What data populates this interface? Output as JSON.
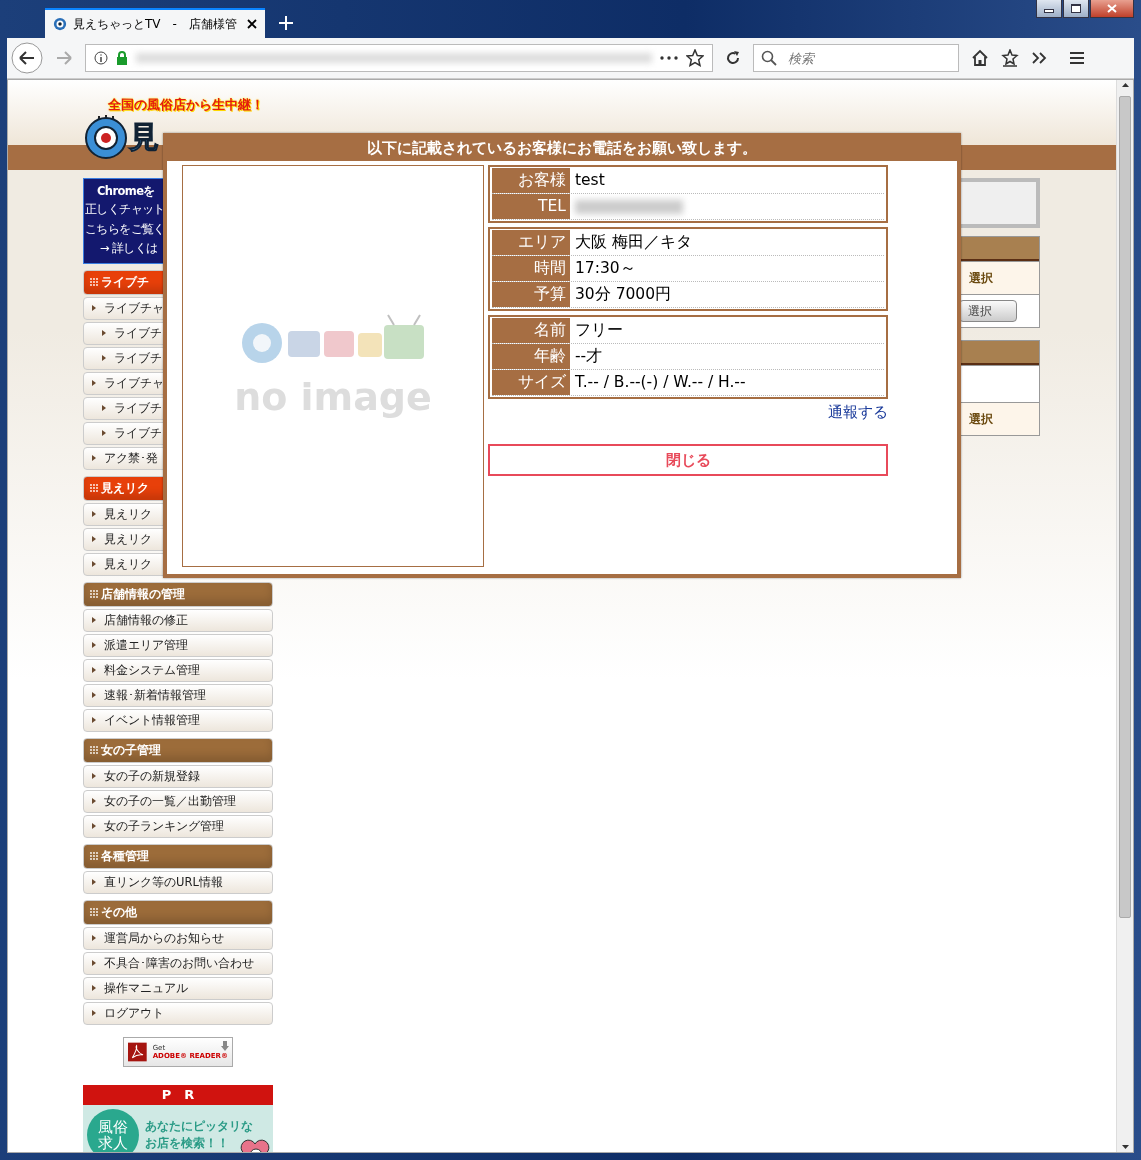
{
  "browser": {
    "tab_title": "見えちゃっとTV　-　店舗様管",
    "search_placeholder": "検索"
  },
  "header": {
    "tagline": "全国の風俗店から生中継！",
    "logo_parts": [
      "見"
    ]
  },
  "notice": {
    "title": "Chromeを",
    "lines": [
      "正しくチャット",
      "こちらをご覧く",
      "→ 詳しくは"
    ]
  },
  "sidebar": [
    {
      "title": "ライブチ",
      "color": "#e8400a",
      "items": [
        {
          "label": "ライブチャ",
          "children": [
            {
              "label": "ライブチ"
            },
            {
              "label": "ライブチ"
            }
          ]
        },
        {
          "label": "ライブチャ",
          "children": [
            {
              "label": "ライブチ"
            },
            {
              "label": "ライブチ"
            }
          ]
        },
        {
          "label": "アク禁･発"
        }
      ]
    },
    {
      "title": "見えリク",
      "color": "#e8400a",
      "items": [
        {
          "label": "見えリク"
        },
        {
          "label": "見えリク"
        },
        {
          "label": "見えリク"
        }
      ]
    },
    {
      "title": "店舗情報の管理",
      "color": "#9c6c3a",
      "items": [
        {
          "label": "店舗情報の修正"
        },
        {
          "label": "派遣エリア管理"
        },
        {
          "label": "料金システム管理"
        },
        {
          "label": "速報･新着情報管理"
        },
        {
          "label": "イベント情報管理"
        }
      ]
    },
    {
      "title": "女の子管理",
      "color": "#9c6c3a",
      "items": [
        {
          "label": "女の子の新規登録"
        },
        {
          "label": "女の子の一覧／出勤管理"
        },
        {
          "label": "女の子ランキング管理"
        }
      ]
    },
    {
      "title": "各種管理",
      "color": "#9c6c3a",
      "items": [
        {
          "label": "直リンク等のURL情報"
        }
      ]
    },
    {
      "title": "その他",
      "color": "#9c6c3a",
      "items": [
        {
          "label": "運営局からのお知らせ"
        },
        {
          "label": "不具合･障害のお問い合わせ"
        },
        {
          "label": "操作マニュアル"
        },
        {
          "label": "ログアウト"
        }
      ]
    }
  ],
  "adobe_badge": {
    "get": "Get",
    "product": "ADOBE® READER®"
  },
  "pr": {
    "title": "P　R",
    "badge": [
      "風俗",
      "求人"
    ],
    "text": [
      "あなたにピッタリな",
      "お店を検索！！"
    ]
  },
  "main_tables": [
    {
      "rows": [
        {
          "kind": "text",
          "label": "選択"
        },
        {
          "kind": "button",
          "label": "選択"
        }
      ]
    },
    {
      "rows": [
        {
          "kind": "empty"
        },
        {
          "kind": "text",
          "label": "選択"
        }
      ]
    }
  ],
  "modal": {
    "title": "以下に記載されているお客様にお電話をお願い致します。",
    "photo_text": "no image",
    "groups": [
      [
        {
          "label": "お客様",
          "value": "test"
        },
        {
          "label": "TEL",
          "redacted": true
        }
      ],
      [
        {
          "label": "エリア",
          "value": "大阪 梅田／キタ"
        },
        {
          "label": "時間",
          "value": "17:30～"
        },
        {
          "label": "予算",
          "value": "30分 7000円"
        }
      ],
      [
        {
          "label": "名前",
          "value": "フリー"
        },
        {
          "label": "年齢",
          "value": "--才"
        },
        {
          "label": "サイズ",
          "value": "T.-- / B.--(-) / W.-- / H.--"
        }
      ]
    ],
    "report_link": "通報する",
    "close_button": "閉じる"
  }
}
